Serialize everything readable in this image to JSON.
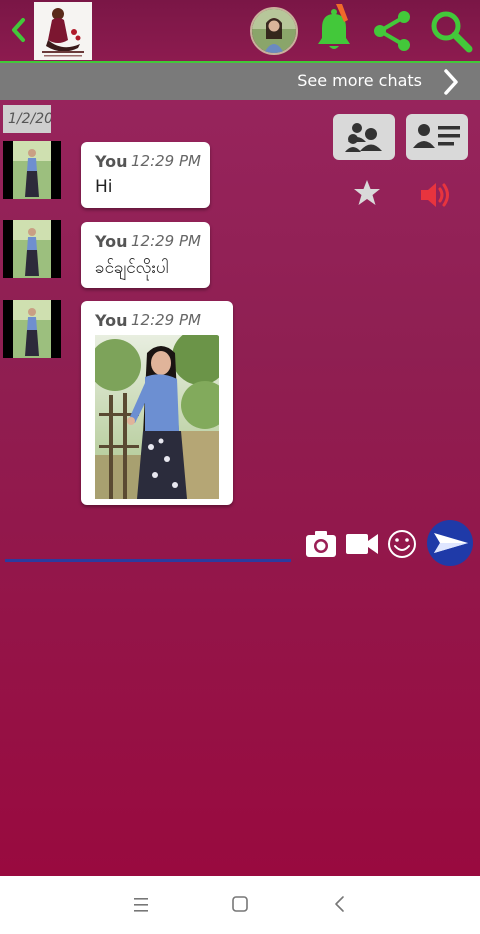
{
  "header": {
    "back_icon": "chevron-left-icon",
    "logo_icon": "app-logo-icon",
    "avatar_icon": "profile-avatar",
    "notification_icon": "bell-icon",
    "share_icon": "share-icon",
    "search_icon": "search-icon"
  },
  "more_chats": {
    "label": "See more chats",
    "chevron_icon": "chevron-right-icon"
  },
  "date_chip": "1/2/20",
  "actions": {
    "group_icon": "group-icon",
    "contact_card_icon": "contact-card-icon",
    "star_icon": "star-icon",
    "speaker_icon": "speaker-icon"
  },
  "messages": [
    {
      "sender": "You",
      "time": "12:29 PM",
      "text": "Hi"
    },
    {
      "sender": "You",
      "time": "12:29 PM",
      "text": "ခင်ချင်လိုးပါ"
    },
    {
      "sender": "You",
      "time": "12:29 PM",
      "text": "",
      "attachment": "photo"
    }
  ],
  "composer": {
    "camera_icon": "camera-icon",
    "video_icon": "video-camera-icon",
    "emoji_icon": "smiley-icon",
    "send_icon": "send-icon"
  },
  "colors": {
    "header_bg": "#8d1b4f",
    "accent_green": "#43c83a",
    "chat_bg_top": "#9a2660",
    "chat_bg_bottom": "#990a3f",
    "bar_gray": "#7a7a7a",
    "send_blue": "#1f3aa8"
  }
}
